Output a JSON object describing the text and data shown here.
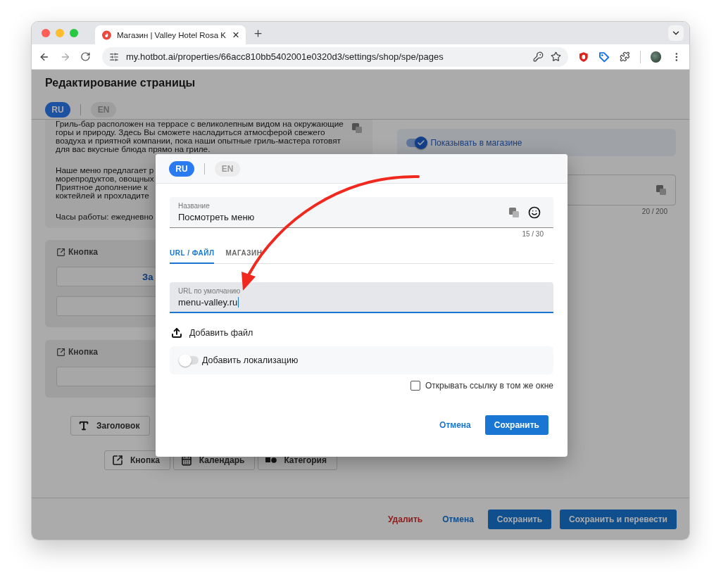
{
  "browser": {
    "tab_title": "Магазин | Valley Hotel Rosa K",
    "url": "my.hotbot.ai/properties/66acc810bb5402001e0320d3/settings/shop/spe/pages"
  },
  "page": {
    "title": "Редактирование страницы",
    "languages": [
      {
        "label": "RU",
        "selected": true
      },
      {
        "label": "EN",
        "selected": false
      }
    ],
    "description": [
      [
        "Гриль-бар расположен на террасе с великолепным видом на окружающие",
        "горы и природу. Здесь Вы сможете насладиться атмосферой свежего",
        "воздуха и приятной компании, пока наши опытные гриль-мастера готовят",
        "для вас вкусные блюда прямо на гриле."
      ],
      [
        "Наше меню предлагает р",
        "морепродуктов, овощных",
        "Приятное дополнение к",
        "коктейлей и прохладите"
      ],
      [
        "Часы работы: ежедневно"
      ]
    ],
    "button_blocks": [
      {
        "title": "Кнопка",
        "fields": [
          {
            "kind": "text",
            "value": "За"
          },
          {
            "kind": "blank"
          }
        ]
      },
      {
        "title": "Кнопка",
        "fields": [
          {
            "kind": "blank"
          }
        ]
      }
    ],
    "add_rows": [
      [
        {
          "kind": "heading",
          "label": "Заголовок"
        }
      ],
      [
        {
          "kind": "button",
          "label": "Кнопка"
        },
        {
          "kind": "calendar",
          "label": "Календарь"
        },
        {
          "kind": "category",
          "label": "Категория"
        }
      ]
    ],
    "show_in_shop": {
      "label": "Показывать в магазине",
      "on": true
    },
    "side_field_counter": "20 / 200",
    "footer": {
      "delete": "Удалить",
      "cancel": "Отмена",
      "save": "Сохранить",
      "save_and_translate": "Сохранить и перевести"
    }
  },
  "dialog": {
    "languages": [
      {
        "label": "RU",
        "selected": true
      },
      {
        "label": "EN",
        "selected": false
      }
    ],
    "name_field": {
      "label": "Название",
      "value": "Посмотреть меню",
      "counter": "15 / 30"
    },
    "tabs": [
      {
        "label": "URL / ФАЙЛ",
        "selected": true
      },
      {
        "label": "МАГАЗИН",
        "selected": false
      }
    ],
    "url_field": {
      "label": "URL по умолчанию",
      "value": "menu-valley.ru",
      "focused": true
    },
    "add_file": "Добавить файл",
    "localization": {
      "label": "Добавить локализацию",
      "on": false
    },
    "same_window": {
      "label": "Открывать ссылку в том же окне",
      "checked": false
    },
    "cancel": "Отмена",
    "save": "Сохранить"
  }
}
